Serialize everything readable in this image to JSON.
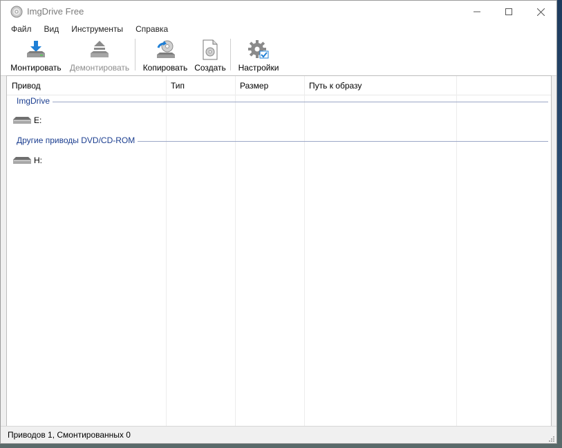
{
  "window": {
    "title": "ImgDrive Free"
  },
  "menu": [
    "Файл",
    "Вид",
    "Инструменты",
    "Справка"
  ],
  "toolbar": {
    "mount": "Монтировать",
    "unmount": "Демонтировать",
    "copy": "Копировать",
    "create": "Создать",
    "settings": "Настройки"
  },
  "columns": [
    "Привод",
    "Тип",
    "Размер",
    "Путь к образу"
  ],
  "groups": [
    {
      "label": "ImgDrive",
      "drives": [
        "E:"
      ]
    },
    {
      "label": "Другие приводы DVD/CD-ROM",
      "drives": [
        "H:"
      ]
    }
  ],
  "status": "Приводов 1, Смонтированных 0",
  "colors": {
    "group_text": "#1a3d8f",
    "mount_arrow": "#1e7fd6"
  }
}
